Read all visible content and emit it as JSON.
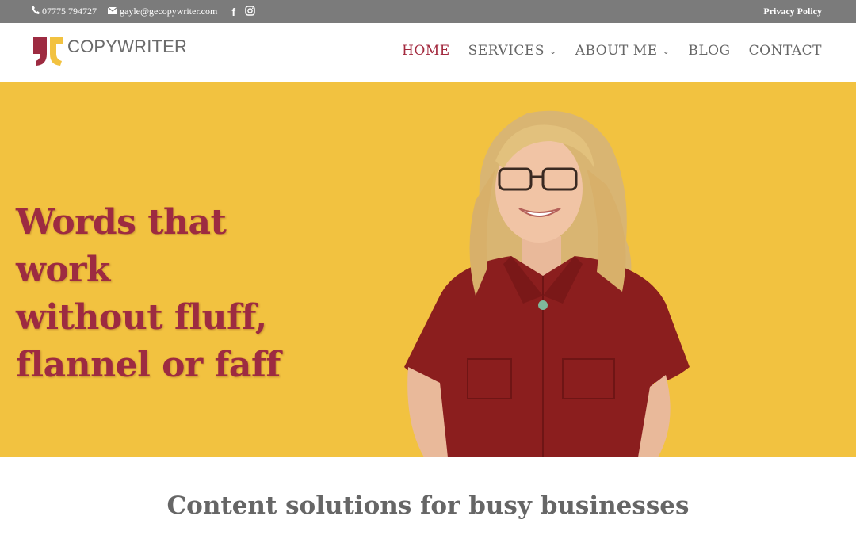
{
  "topbar": {
    "phone": "07775 794727",
    "email": "gayle@gecopywriter.com",
    "privacy": "Privacy Policy",
    "social": [
      "facebook-icon",
      "instagram-icon"
    ]
  },
  "logo": {
    "text": "COPYWRITER"
  },
  "nav": {
    "items": [
      {
        "label": "HOME",
        "active": true
      },
      {
        "label": "SERVICES",
        "dropdown": true
      },
      {
        "label": "ABOUT ME",
        "dropdown": true
      },
      {
        "label": "BLOG"
      },
      {
        "label": "CONTACT"
      }
    ]
  },
  "hero": {
    "line1": "Words that work",
    "line2": "without fluff,",
    "line3": "flannel or faff"
  },
  "section": {
    "tagline": "Content solutions for busy businesses"
  },
  "colors": {
    "brand": "#9d2b41",
    "hero_bg": "#f2c240",
    "topbar": "#7b7b7b"
  }
}
